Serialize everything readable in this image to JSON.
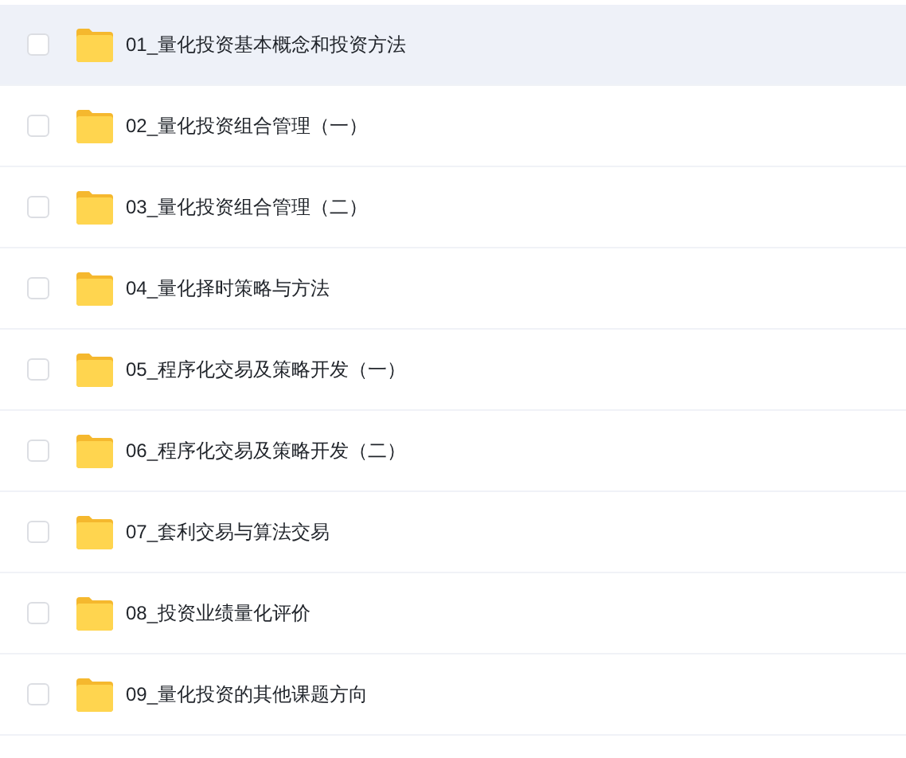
{
  "files": [
    {
      "name": "01_量化投资基本概念和投资方法",
      "checked": false,
      "highlighted": true
    },
    {
      "name": "02_量化投资组合管理（一）",
      "checked": false,
      "highlighted": false
    },
    {
      "name": "03_量化投资组合管理（二）",
      "checked": false,
      "highlighted": false
    },
    {
      "name": "04_量化择时策略与方法",
      "checked": false,
      "highlighted": false
    },
    {
      "name": "05_程序化交易及策略开发（一）",
      "checked": false,
      "highlighted": false
    },
    {
      "name": "06_程序化交易及策略开发（二）",
      "checked": false,
      "highlighted": false
    },
    {
      "name": "07_套利交易与算法交易",
      "checked": false,
      "highlighted": false
    },
    {
      "name": "08_投资业绩量化评价",
      "checked": false,
      "highlighted": false
    },
    {
      "name": "09_量化投资的其他课题方向",
      "checked": false,
      "highlighted": false
    }
  ]
}
